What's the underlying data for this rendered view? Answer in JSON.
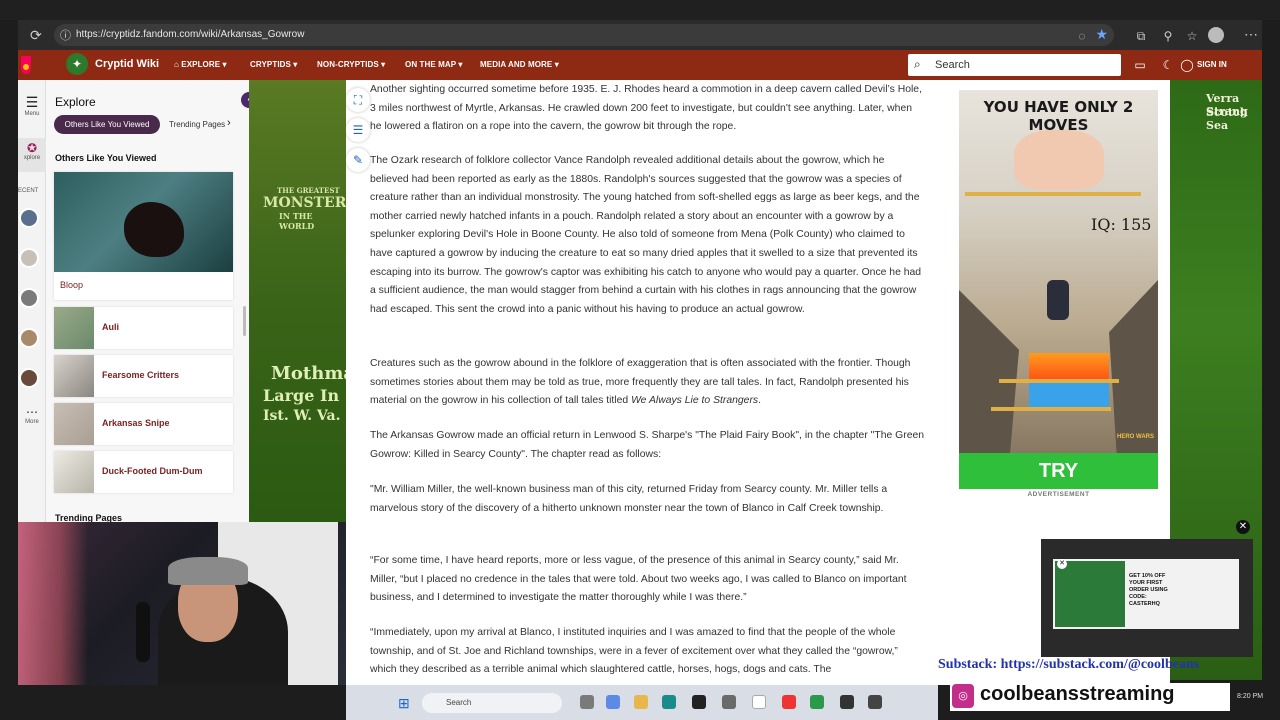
{
  "browser": {
    "url": "https://cryptidz.fandom.com/wiki/Arkansas_Gowrow"
  },
  "nav": {
    "site_name": "Cryptid Wiki",
    "items": [
      "EXPLORE",
      "CRYPTIDS",
      "NON-CRYPTIDS",
      "ON THE MAP",
      "MEDIA AND MORE"
    ],
    "search_placeholder": "Search",
    "sign_in": "SIGN IN"
  },
  "rail": {
    "menu": "Menu",
    "explore": "xplore",
    "recent": "ECENT",
    "more": "More"
  },
  "sidebar": {
    "title": "Explore",
    "tab_active": "Others Like You Viewed",
    "tab_other": "Trending Pages",
    "section": "Others Like You Viewed",
    "featured": "Bloop",
    "items": [
      "Auli",
      "Fearsome Critters",
      "Arkansas Snipe",
      "Duck-Footed Dum-Dum"
    ],
    "trending": "Trending Pages"
  },
  "article": {
    "paragraphs": [
      "Another sighting occurred sometime before 1935. E. J. Rhodes heard a commotion in a deep cavern called Devil’s Hole, 3 miles northwest of Myrtle, Arkansas. He crawled down 200 feet to investigate, but couldn't see anything. Later, when he lowered a flatiron on a rope into the cavern, the gowrow bit through the rope.",
      "The Ozark research of folklore collector Vance Randolph revealed additional details about the gowrow, which he believed had been reported as early as the 1880s. Randolph's sources suggested that the gowrow was a species of creature rather than an individual monstrosity. The young hatched from soft-shelled eggs as large as beer kegs, and the mother carried newly hatched infants in a pouch. Randolph related a story about an encounter with a gowrow by a spelunker exploring Devil's Hole in Boone County. He also told of someone from Mena (Polk County) who claimed to have captured a gowrow by inducing the creature to eat so many dried apples that it swelled to a size that prevented its escaping into its burrow. The gowrow's captor was exhibiting his catch to anyone who would pay a quarter. Once he had a sufficient audience, the man would stagger from behind a curtain with his clothes in rags announcing that the gowrow had escaped. This sent the crowd into a panic without his having to produce an actual gowrow.",
      "Creatures such as the gowrow abound in the folklore of exaggeration that is often associated with the frontier. Though sometimes stories about them may be told as true, more frequently they are tall tales. In fact, Randolph presented his material on the gowrow in his collection of tall tales titled",
      "The Arkansas Gowrow made an official return in Lenwood S. Sharpe's \"The Plaid Fairy Book\", in the chapter \"The Green Gowrow: Killed in Searcy County\". The chapter read as follows:",
      "\"Mr. William Miller, the well-known business man of this city, returned Friday from Searcy county. Mr. Miller tells a marvelous story of the discovery of a hitherto unknown monster near the town of Blanco in Calf Creek township.",
      "“For some time, I have heard reports, more or less vague, of the presence of this animal in Searcy county,” said Mr. Miller, “but I placed no credence in the tales that were told. About two weeks ago, I was called to Blanco on important business, and I determined to investigate the matter thoroughly while I was there.”",
      "“Immediately, upon my arrival at Blanco, I instituted inquiries and I was amazed to find that the people of the whole township, and of St. Joe and Richland townships, were in a fever of excitement over what they called the “gowrow,” which they described as a terrible animal which slaughtered cattle, horses, hogs, dogs and cats. The"
    ],
    "book_title": "We Always Lie to Strangers",
    "book_suffix": "."
  },
  "ad": {
    "headline": "YOU HAVE ONLY 2 MOVES",
    "iq": "IQ: 155",
    "cta": "TRY",
    "brand": "HERO WARS",
    "label": "ADVERTISEMENT"
  },
  "background": {
    "left_text": [
      "THE GREATEST",
      "MONSTERS",
      "IN THE WORLD",
      "Mothman",
      "Large In",
      "Ist. W. Va."
    ],
    "right_text": [
      "Verra Strang",
      "Scotch Sea"
    ]
  },
  "video_ad": {
    "promo": "GET 10% OFF YOUR FIRST ORDER USING CODE: CASTERHQ"
  },
  "stream": {
    "substack": "Substack: https://substack.com/@coolbeans",
    "instagram": "coolbeansstreaming",
    "time": "8:20 PM"
  },
  "taskbar": {
    "search": "Search"
  },
  "colors": {
    "nav_bg": "#8e2a13",
    "link": "#7a1f1f",
    "accent_purple": "#4a2a4a",
    "substack_text": "#2233aa"
  }
}
